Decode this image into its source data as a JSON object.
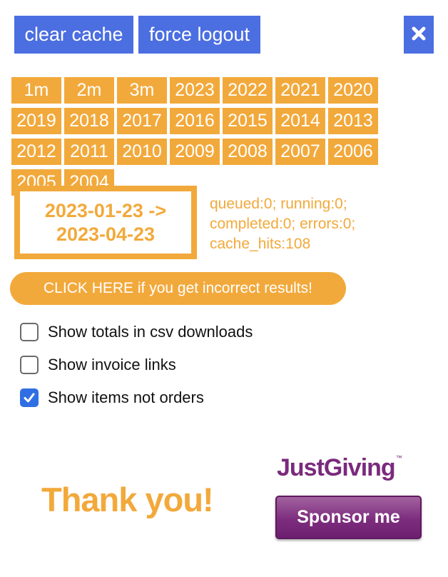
{
  "toolbar": {
    "clear_cache_label": "clear cache",
    "force_logout_label": "force logout",
    "close_icon": "close-icon"
  },
  "periods": [
    "1m",
    "2m",
    "3m",
    "2023",
    "2022",
    "2021",
    "2020",
    "2019",
    "2018",
    "2017",
    "2016",
    "2015",
    "2014",
    "2013",
    "2012",
    "2011",
    "2010",
    "2009",
    "2008",
    "2007",
    "2006",
    "2005",
    "2004"
  ],
  "date_range": {
    "line1": "2023-01-23 ->",
    "line2": "2023-04-23"
  },
  "stats": {
    "line1": "queued:0; running:0;",
    "line2": "completed:0; errors:0;",
    "line3": "cache_hits:108"
  },
  "alert_button_label": "CLICK HERE if you get incorrect results!",
  "options": [
    {
      "label": "Show totals in csv downloads",
      "checked": false
    },
    {
      "label": "Show invoice links",
      "checked": false
    },
    {
      "label": "Show items not orders",
      "checked": true
    }
  ],
  "footer": {
    "thanks": "Thank you!",
    "justgiving_logo": "JustGiving",
    "trademark": "™",
    "sponsor_label": "Sponsor me"
  },
  "colors": {
    "blue_button": "#4b6ee0",
    "orange": "#f2a93b",
    "justgiving_purple": "#7a2a7c",
    "checkbox_blue": "#2f6fe3"
  }
}
